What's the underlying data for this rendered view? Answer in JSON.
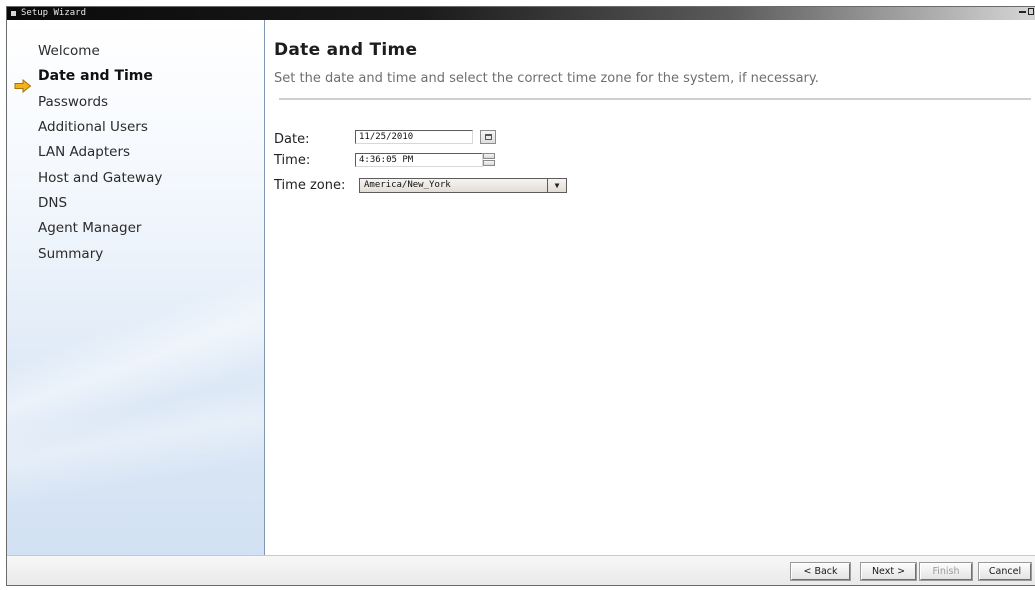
{
  "window": {
    "title": "Setup Wizard"
  },
  "sidebar": {
    "items": [
      {
        "label": "Welcome",
        "active": false
      },
      {
        "label": "Date and Time",
        "active": true
      },
      {
        "label": "Passwords",
        "active": false
      },
      {
        "label": "Additional Users",
        "active": false
      },
      {
        "label": "LAN Adapters",
        "active": false
      },
      {
        "label": "Host and Gateway",
        "active": false
      },
      {
        "label": "DNS",
        "active": false
      },
      {
        "label": "Agent Manager",
        "active": false
      },
      {
        "label": "Summary",
        "active": false
      }
    ],
    "active_icon": "arrow-right-icon"
  },
  "main": {
    "title": "Date and Time",
    "description": "Set the date and time and select the correct time zone for the system, if necessary.",
    "fields": {
      "date_label": "Date:",
      "date_value": "11/25/2010",
      "time_label": "Time:",
      "time_value": "4:36:05 PM",
      "timezone_label": "Time zone:",
      "timezone_value": "America/New_York"
    }
  },
  "footer": {
    "back_label": "< Back",
    "next_label": "Next >",
    "finish_label": "Finish",
    "cancel_label": "Cancel"
  },
  "colors": {
    "sidebar_gradient_bottom": "#d2e1f3",
    "arrow": "#f2b21d",
    "title_bar": "#0a0a0a"
  }
}
